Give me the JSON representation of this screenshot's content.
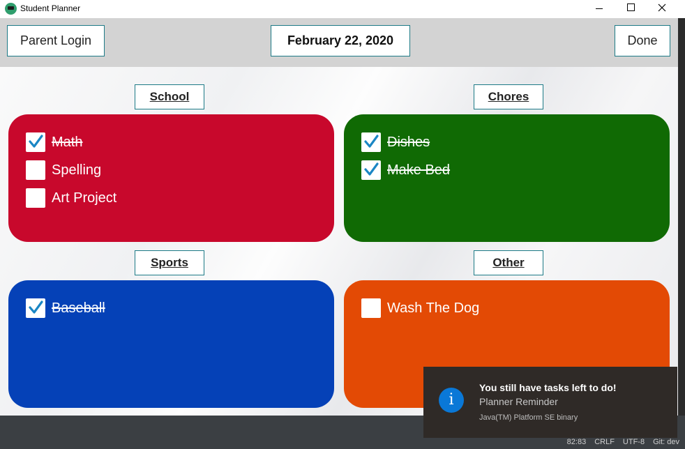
{
  "window": {
    "title": "Student Planner"
  },
  "toolbar": {
    "parent_login": "Parent Login",
    "date": "February 22, 2020",
    "done": "Done"
  },
  "categories": [
    {
      "label": "School",
      "color": "#c8082c",
      "tasks": [
        {
          "label": "Math",
          "checked": true
        },
        {
          "label": "Spelling",
          "checked": false
        },
        {
          "label": "Art Project",
          "checked": false
        }
      ]
    },
    {
      "label": "Chores",
      "color": "#106a04",
      "tasks": [
        {
          "label": "Dishes",
          "checked": true
        },
        {
          "label": "Make Bed",
          "checked": true
        }
      ]
    },
    {
      "label": "Sports",
      "color": "#0541b7",
      "tasks": [
        {
          "label": "Baseball",
          "checked": true
        }
      ]
    },
    {
      "label": "Other",
      "color": "#e34a05",
      "tasks": [
        {
          "label": "Wash The Dog",
          "checked": false
        }
      ]
    }
  ],
  "notification": {
    "icon": "info-icon",
    "title": "You still have tasks left to do!",
    "subtitle": "Planner Reminder",
    "source": "Java(TM) Platform SE binary"
  },
  "status_bar": {
    "position": "82:83",
    "line_ending": "CRLF",
    "encoding": "UTF-8",
    "branch": "Git: dev"
  }
}
